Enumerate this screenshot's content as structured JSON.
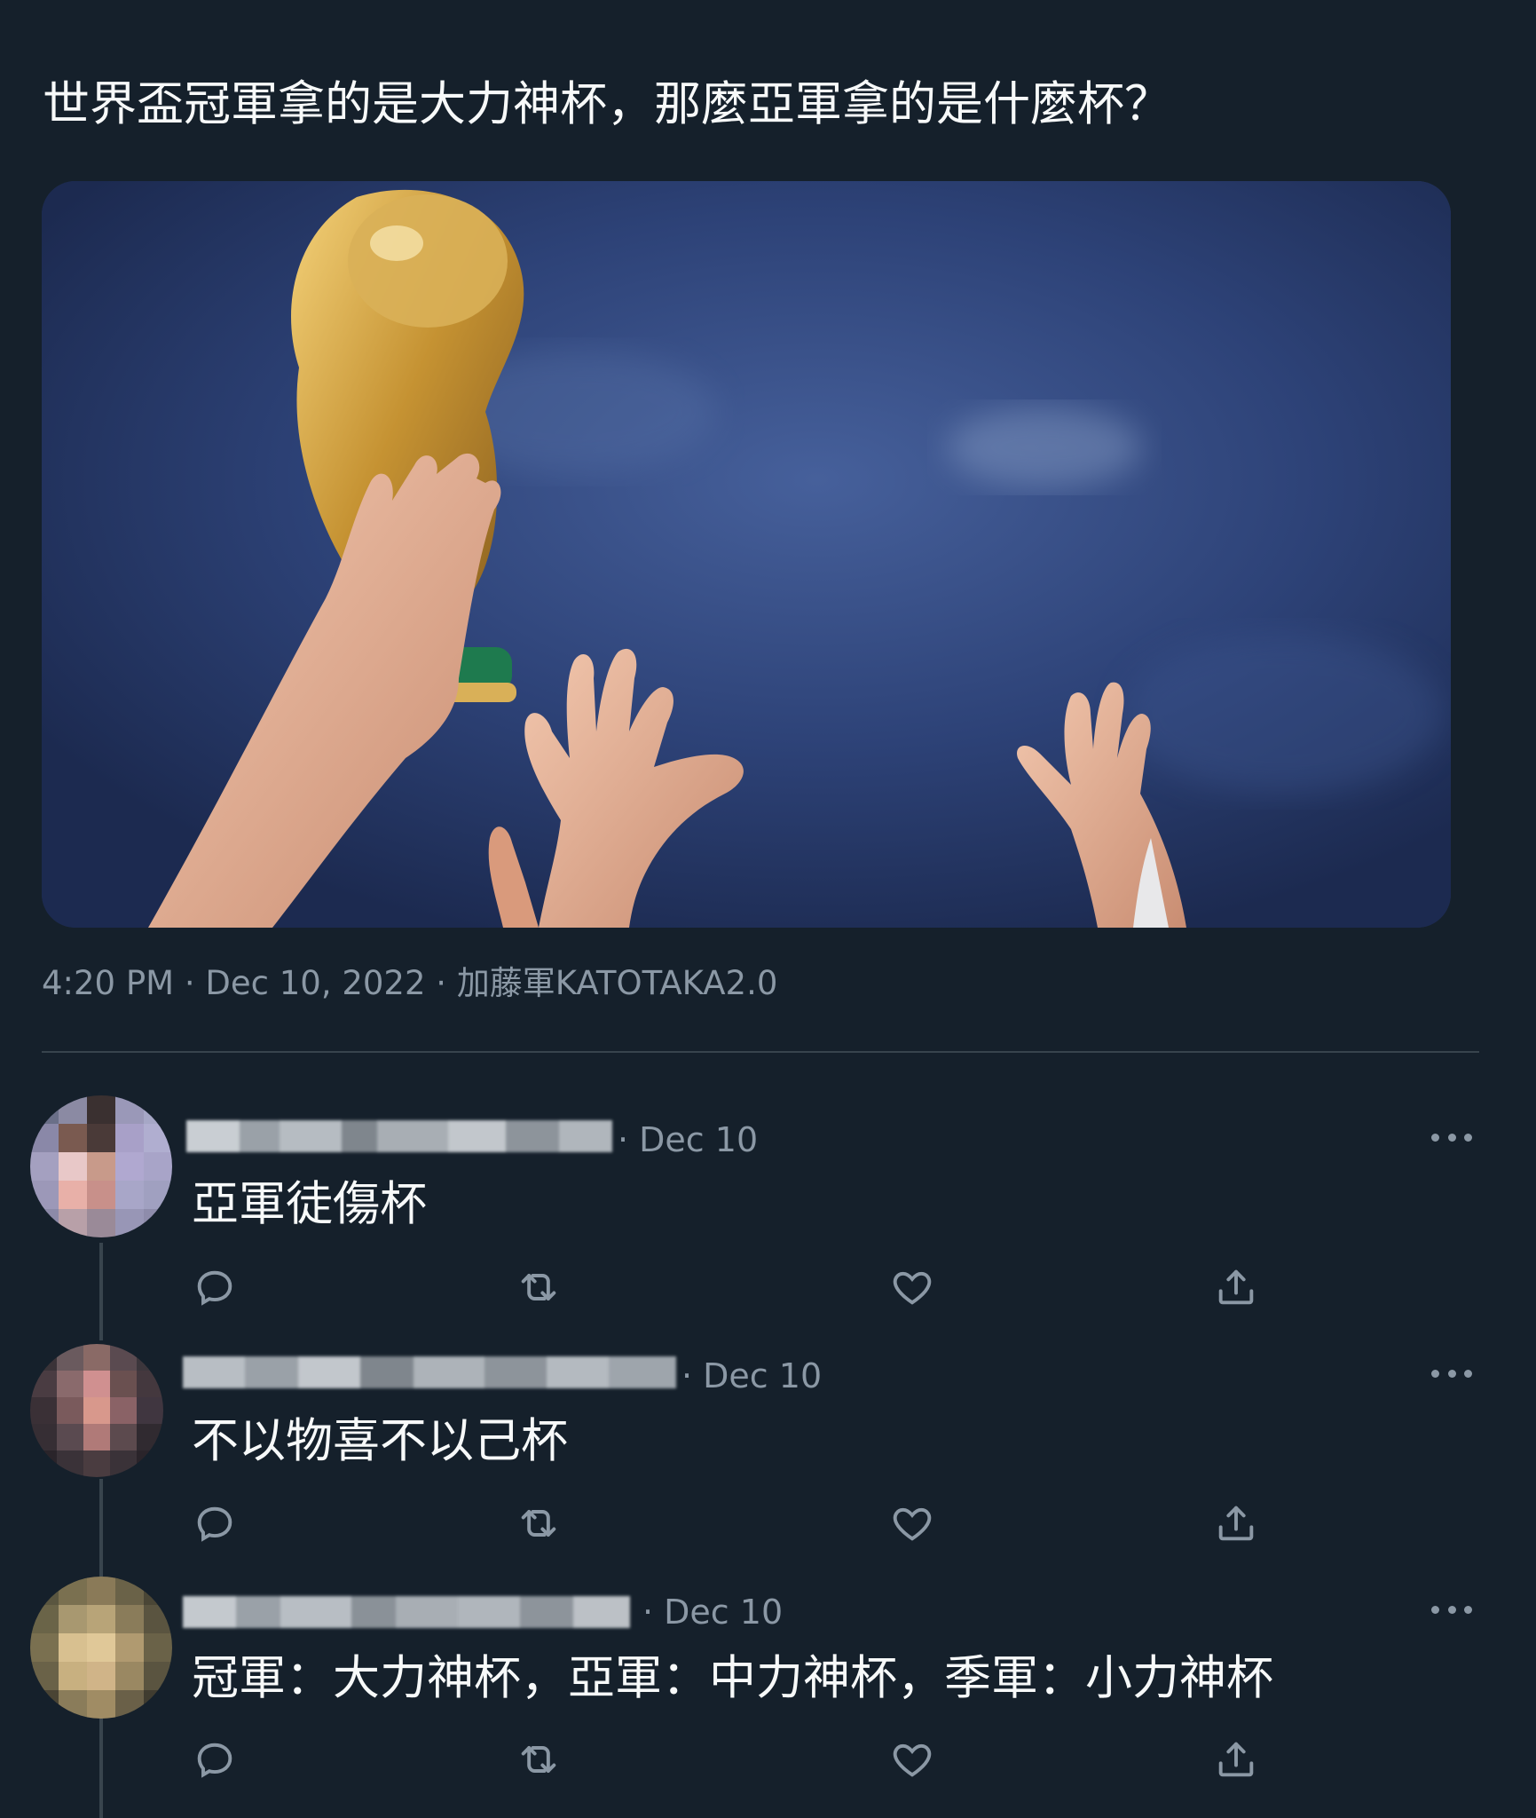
{
  "tweet": {
    "text": "世界盃冠軍拿的是大力神杯，那麼亞軍拿的是什麼杯？",
    "time": "4:20 PM",
    "date": "Dec 10, 2022",
    "source": "加藤軍KATOTAKA2.0",
    "meta_separator": " · ",
    "media_icon": "world-cup-trophy-photo"
  },
  "replies": [
    {
      "date": "Dec 10",
      "text": "亞軍徒傷杯"
    },
    {
      "date": "Dec 10",
      "text": "不以物喜不以己杯"
    },
    {
      "date": "Dec 10",
      "text": "冠軍：大力神杯，亞軍：中力神杯，季軍：小力神杯"
    }
  ],
  "date_prefix": "· ",
  "colors": {
    "background": "#15202b",
    "text": "#f7f9f9",
    "secondary": "#8b98a5",
    "divider": "#38444d"
  },
  "icons": {
    "reply": "reply-icon",
    "retweet": "retweet-icon",
    "like": "like-icon",
    "share": "share-icon",
    "more": "more-icon"
  }
}
